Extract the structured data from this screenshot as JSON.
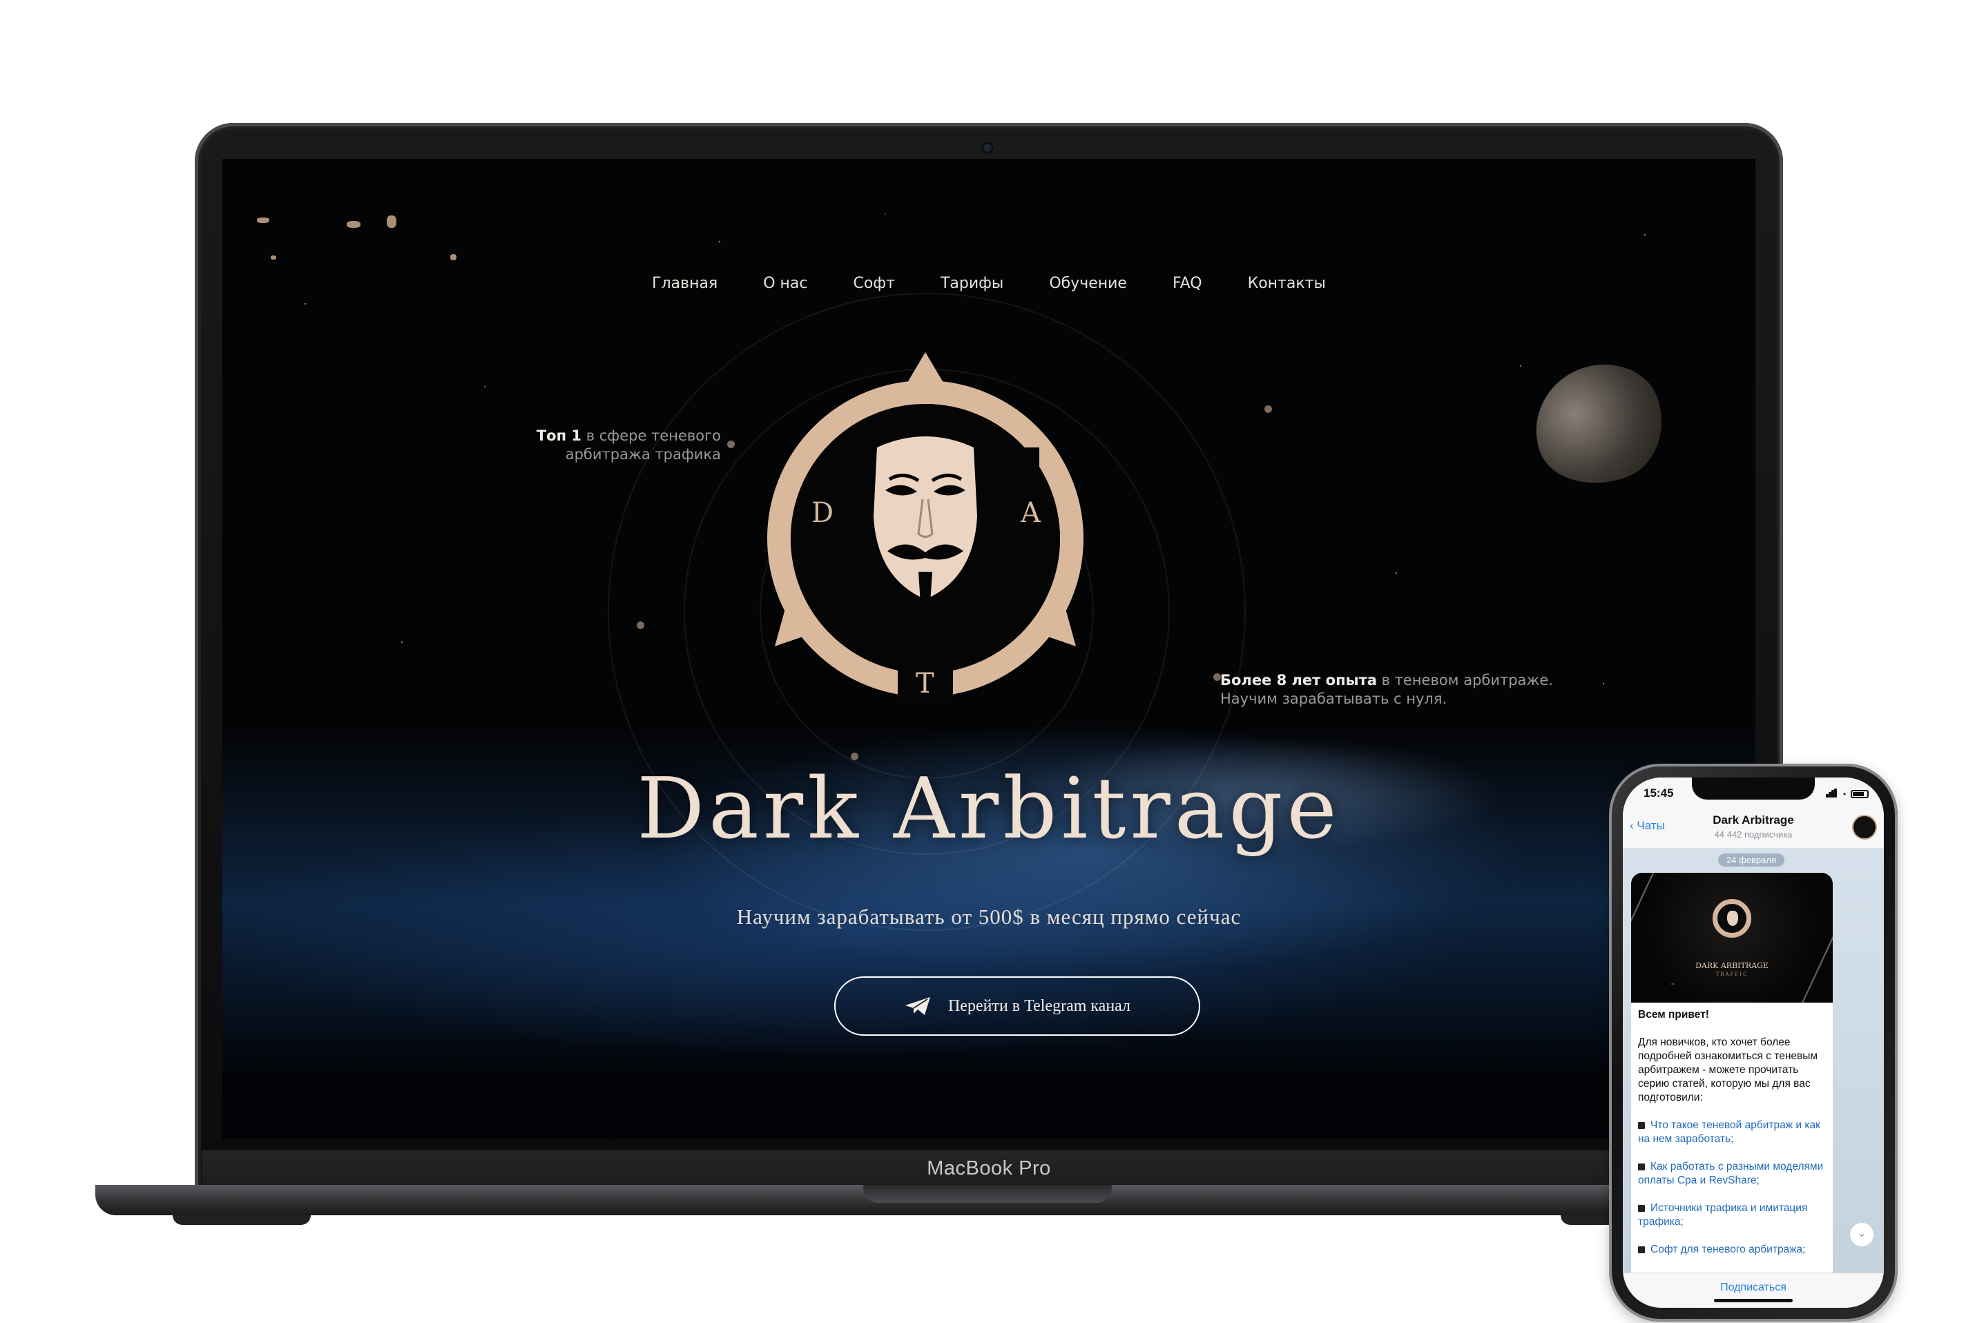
{
  "site": {
    "nav": [
      "Главная",
      "О нас",
      "Софт",
      "Тарифы",
      "Обучение",
      "FAQ",
      "Контакты"
    ],
    "left_blurb": {
      "bold": "Топ 1",
      "rest_line1": " в сфере теневого",
      "line2": "арбитража трафика"
    },
    "right_blurb": {
      "bold": "Более 8 лет опыта",
      "rest_line1": " в теневом арбитраже.",
      "line2": "Научим зарабатывать с нуля."
    },
    "logo_letters": {
      "left": "D",
      "right": "A",
      "bottom": "T"
    },
    "title": "Dark Arbitrage",
    "subtitle": "Научим зарабатывать от 500$ в месяц прямо сейчас",
    "cta_label": "Перейти в Telegram канал"
  },
  "laptop": {
    "brand": "MacBook Pro"
  },
  "phone": {
    "time": "15:45",
    "back_label": "Чаты",
    "channel_name": "Dark Arbitrage",
    "subscribers": "44 442 подписчика",
    "date": "24 февраля",
    "preview_title": "DARK ARBITRAGE",
    "preview_tag": "TRAFFIC",
    "greeting": "Всем привет!",
    "intro": "Для новичков, кто хочет более подробней ознакомиться с теневым арбитражем - можете прочитать серию статей, которую мы для вас подготовили:",
    "links": [
      "Что такое теневой арбитраж и как на нем заработать;",
      "Как работать с разными моделями оплаты Cpa и RevShare;",
      "Источники трафика и имитация трафика;",
      "Софт для теневого арбитража;"
    ],
    "subscribe_label": "Подписаться"
  },
  "colors": {
    "accent_gold": "#d9b89c",
    "link_blue": "#2a82d9"
  }
}
